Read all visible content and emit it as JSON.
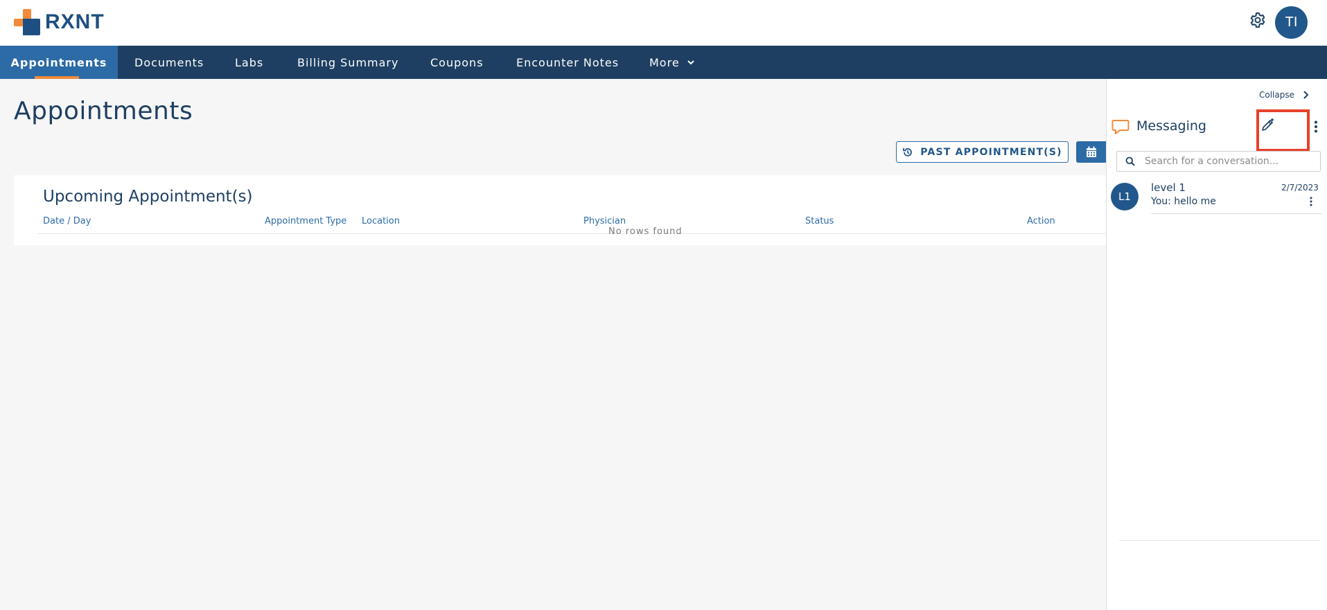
{
  "header": {
    "logo_text": "RXNT",
    "user_initials": "TI"
  },
  "nav": {
    "items": [
      {
        "label": "Appointments",
        "active": true
      },
      {
        "label": "Documents"
      },
      {
        "label": "Labs"
      },
      {
        "label": "Billing Summary"
      },
      {
        "label": "Coupons"
      },
      {
        "label": "Encounter Notes"
      },
      {
        "label": "More"
      }
    ]
  },
  "main": {
    "title": "Appointments",
    "past_button_label": "PAST APPOINTMENT(S)",
    "card": {
      "title": "Upcoming Appointment(s)",
      "columns": [
        "Date / Day",
        "Appointment Type",
        "Location",
        "Physician",
        "Status",
        "Action"
      ],
      "empty_text": "No rows found"
    }
  },
  "messaging": {
    "collapse_label": "Collapse",
    "title": "Messaging",
    "search_placeholder": "Search for a conversation...",
    "conversations": [
      {
        "initials": "L1",
        "name": "level 1",
        "date": "2/7/2023",
        "preview": "You: hello me"
      }
    ]
  },
  "colors": {
    "brand_navy": "#1e3f62",
    "brand_blue": "#2c6ba6",
    "brand_orange": "#f28a3a",
    "highlight_red": "#e8412a"
  }
}
